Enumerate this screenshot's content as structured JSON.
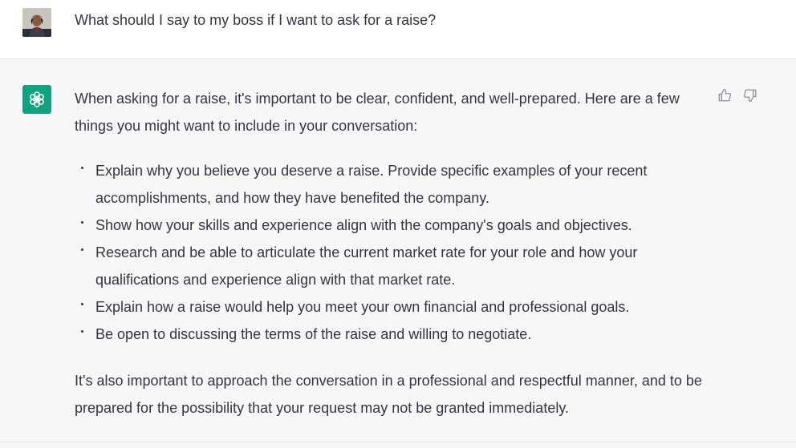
{
  "conversation": {
    "user_message": "What should I say to my boss if I want to ask for a raise?",
    "assistant": {
      "intro": "When asking for a raise, it's important to be clear, confident, and well-prepared. Here are a few things you might want to include in your conversation:",
      "bullets": [
        "Explain why you believe you deserve a raise. Provide specific examples of your recent accomplishments, and how they have benefited the company.",
        "Show how your skills and experience align with the company's goals and objectives.",
        "Research and be able to articulate the current market rate for your role and how your qualifications and experience align with that market rate.",
        "Explain how a raise would help you meet your own financial and professional goals.",
        "Be open to discussing the terms of the raise and willing to negotiate."
      ],
      "closing": "It's also important to approach the conversation in a professional and respectful manner, and to be prepared for the possibility that your request may not be granted immediately."
    }
  },
  "icons": {
    "user_avatar": "user-avatar",
    "assistant_avatar": "openai-logo-icon",
    "thumbs_up": "thumbs-up-icon",
    "thumbs_down": "thumbs-down-icon"
  },
  "colors": {
    "assistant_avatar_bg": "#10a37f",
    "assistant_row_bg": "#f7f7f8",
    "user_row_bg": "#ffffff",
    "text": "#343541"
  }
}
